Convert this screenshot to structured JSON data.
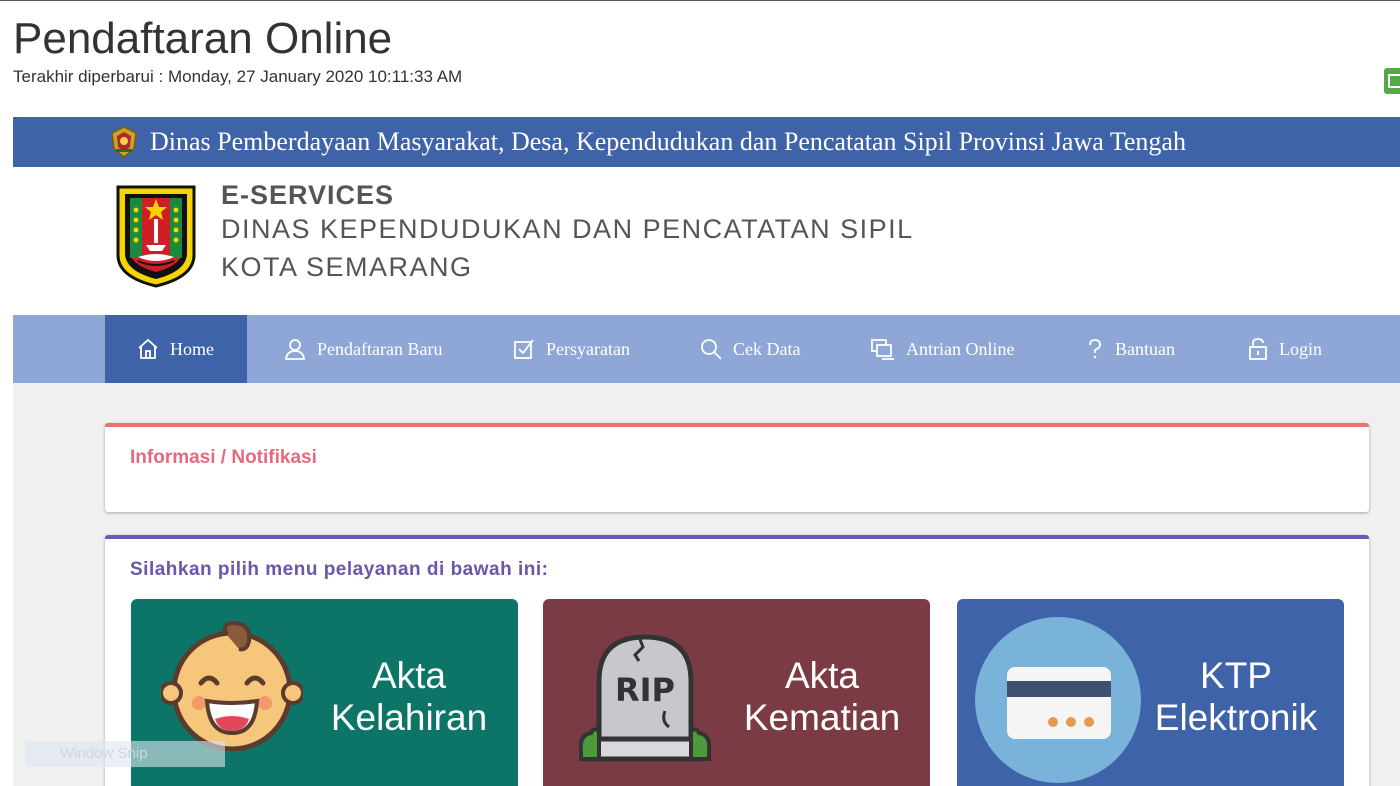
{
  "header": {
    "title": "Pendaftaran Online",
    "updated": "Terakhir diperbarui : Monday, 27 January 2020 10:11:33 AM"
  },
  "banner": {
    "text": "Dinas Pemberdayaan Masyarakat, Desa, Kependudukan dan Pencatatan Sipil Provinsi Jawa Tengah"
  },
  "brand": {
    "line1": "E-SERVICES",
    "line2": "DINAS KEPENDUDUKAN DAN PENCATATAN SIPIL",
    "line3": "KOTA SEMARANG"
  },
  "nav": {
    "items": [
      {
        "label": "Home",
        "icon": "home-icon",
        "active": true
      },
      {
        "label": "Pendaftaran Baru",
        "icon": "user-icon"
      },
      {
        "label": "Persyaratan",
        "icon": "checkbox-icon"
      },
      {
        "label": "Cek Data",
        "icon": "search-icon"
      },
      {
        "label": "Antrian Online",
        "icon": "queue-icon"
      },
      {
        "label": "Bantuan",
        "icon": "help-icon"
      },
      {
        "label": "Login",
        "icon": "lock-icon"
      }
    ]
  },
  "info": {
    "heading": "Informasi / Notifikasi"
  },
  "menu": {
    "heading": "Silahkan pilih menu pelayanan di bawah ini:",
    "tiles": [
      {
        "line1": "Akta",
        "line2": "Kelahiran",
        "icon": "baby-icon",
        "color": "#0d7567"
      },
      {
        "line1": "Akta",
        "line2": "Kematian",
        "icon": "tombstone-icon",
        "color": "#7b3b45"
      },
      {
        "line1": "KTP",
        "line2": "Elektronik",
        "icon": "id-card-icon",
        "color": "#3f63a8"
      }
    ],
    "tombstone_text": "RIP"
  },
  "overlay": {
    "watermark": "Window Snip"
  },
  "colors": {
    "banner": "#3f63a8",
    "nav": "#8fa7d6",
    "nav_active": "#3f63a8",
    "info_accent": "#e97373",
    "menu_accent": "#6c5bb3"
  }
}
